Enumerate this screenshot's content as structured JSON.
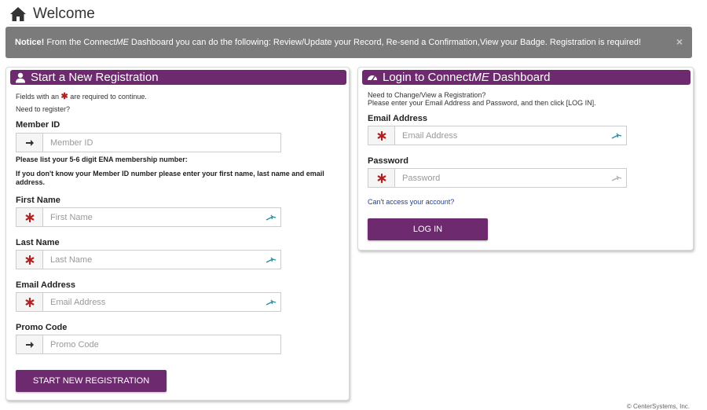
{
  "header": {
    "title": "Welcome"
  },
  "notice": {
    "bold": "Notice!",
    "text_a": " From the Connect",
    "text_me": "ME",
    "text_b": " Dashboard you can do the following: Review/Update your Record, Re-send a Confirmation,View your Badge. Registration is required!",
    "close": "×"
  },
  "registration": {
    "title": "Start a New Registration",
    "required_pre": "Fields with an",
    "required_post": "are required to continue.",
    "need_register": "Need to register?",
    "member_label": "Member ID",
    "member_placeholder": "Member ID",
    "member_note": "Please list your 5-6 digit ENA membership number:",
    "member_note2": "If you don't know your Member ID number please enter your first name, last name and email address.",
    "first_label": "First Name",
    "first_placeholder": "First Name",
    "last_label": "Last Name",
    "last_placeholder": "Last Name",
    "email_label": "Email Address",
    "email_placeholder": "Email Address",
    "promo_label": "Promo Code",
    "promo_placeholder": "Promo Code",
    "button": "START NEW REGISTRATION"
  },
  "login": {
    "title_a": "Login to Connect",
    "title_me": "ME",
    "title_b": " Dashboard",
    "intro1": "Need to Change/View a Registration?",
    "intro2": "Please enter your Email Address and Password, and then click [LOG IN].",
    "email_label": "Email Address",
    "email_placeholder": "Email Address",
    "password_label": "Password",
    "password_placeholder": "Password",
    "cant_access": "Can't access your account?",
    "button": "LOG IN"
  },
  "footer": {
    "text": "© CenterSystems, Inc."
  },
  "colors": {
    "brand": "#6d2a6e",
    "required": "#b22222",
    "notice_bg": "#7b7b7b"
  }
}
